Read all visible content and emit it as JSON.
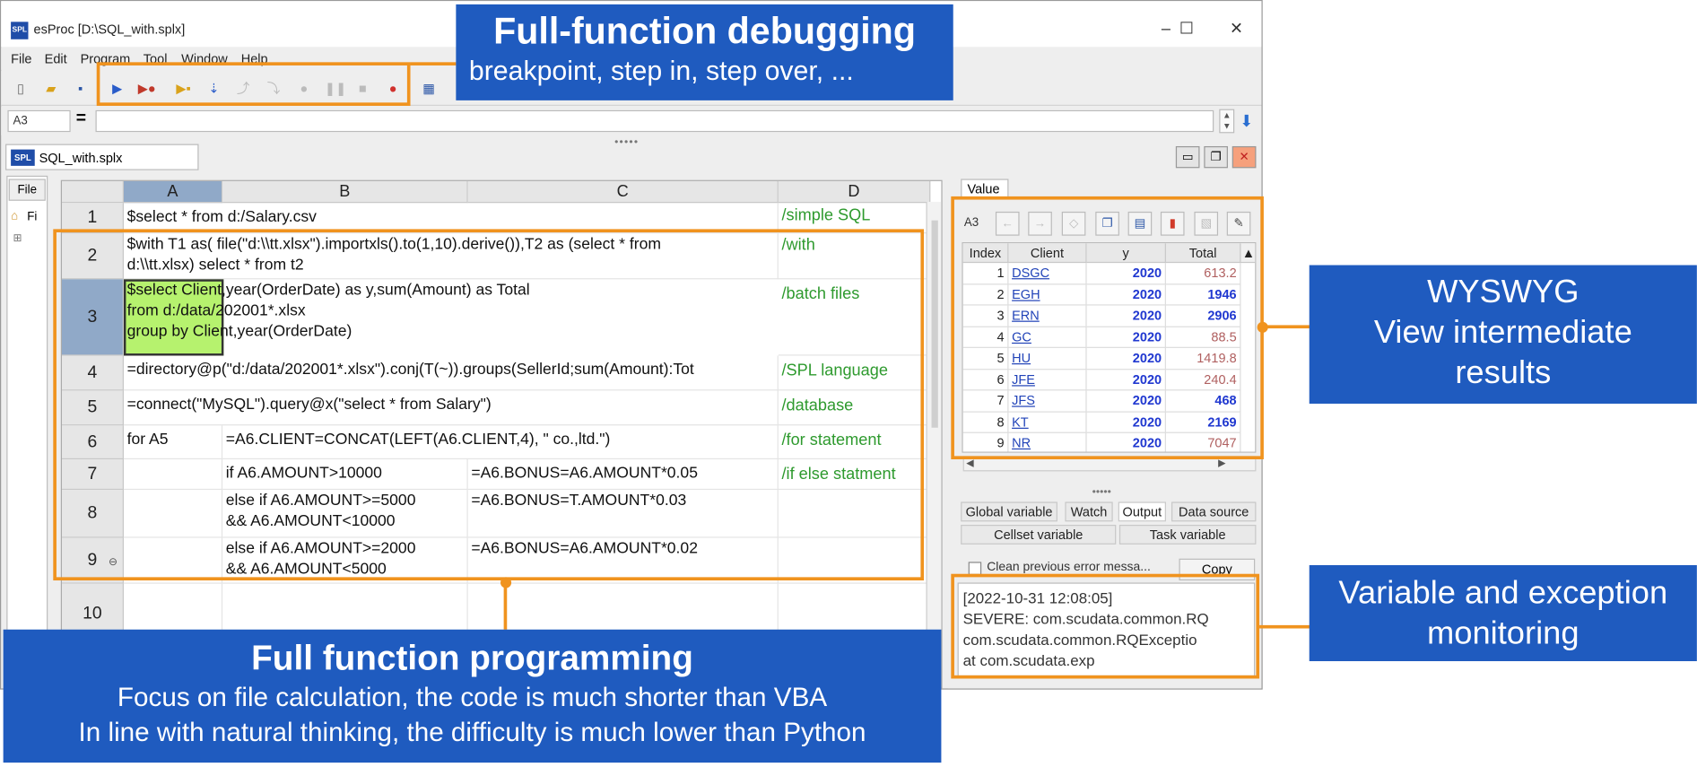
{
  "window": {
    "logo": "SPL",
    "title": "esProc  [D:\\SQL_with.splx]",
    "controls": [
      "–",
      "☐",
      "✕"
    ]
  },
  "menu": [
    "File",
    "Edit",
    "Program",
    "Tool",
    "Window",
    "Help"
  ],
  "formula_bar": {
    "cell_ref": "A3",
    "equals": "=",
    "value": ""
  },
  "document_tab": {
    "logo": "SPL",
    "label": "SQL_with.splx"
  },
  "file_panel": {
    "tab": "File",
    "item": "Fi"
  },
  "grid": {
    "columns": [
      "A",
      "B",
      "C",
      "D"
    ],
    "rows": [
      {
        "num": "1",
        "A": "$select * from d:/Salary.csv",
        "B": "",
        "C": "",
        "D": "/simple SQL"
      },
      {
        "num": "2",
        "A": "$with T1 as( file(\"d:\\\\tt.xlsx\").importxls().to(1,10).derive()),T2 as (select * from\nd:\\\\tt.xlsx) select * from t2",
        "B": "",
        "C": "",
        "D": "/with"
      },
      {
        "num": "3",
        "A": "$select Client,year(OrderDate) as y,sum(Amount) as Total\nfrom d:/data/202001*.xlsx\ngroup by Client,year(OrderDate)",
        "B": "",
        "C": "",
        "D": "/batch files"
      },
      {
        "num": "4",
        "A": "=directory@p(\"d:/data/202001*.xlsx\").conj(T(~)).groups(SellerId;sum(Amount):Tot",
        "B": "",
        "C": "",
        "D": "/SPL language"
      },
      {
        "num": "5",
        "A": "=connect(\"MySQL\").query@x(\"select * from Salary\")",
        "B": "",
        "C": "",
        "D": "/database"
      },
      {
        "num": "6",
        "A": "for A5",
        "B": "=A6.CLIENT=CONCAT(LEFT(A6.CLIENT,4), \" co.,ltd.\")",
        "C": "",
        "D": "/for statement"
      },
      {
        "num": "7",
        "A": "",
        "B": "if A6.AMOUNT>10000",
        "C": "=A6.BONUS=A6.AMOUNT*0.05",
        "D": "/if else statment"
      },
      {
        "num": "8",
        "A": "",
        "B": "else if A6.AMOUNT>=5000\n&& A6.AMOUNT<10000",
        "C": "=A6.BONUS=T.AMOUNT*0.03",
        "D": ""
      },
      {
        "num": "9",
        "A": "",
        "B": "else if A6.AMOUNT>=2000\n&& A6.AMOUNT<5000",
        "C": "=A6.BONUS=A6.AMOUNT*0.02",
        "D": ""
      },
      {
        "num": "10",
        "A": "",
        "B": "",
        "C": "",
        "D": ""
      }
    ]
  },
  "value_panel": {
    "tab": "Value",
    "cell_ref": "A3",
    "headers": [
      "Index",
      "Client",
      "y",
      "Total"
    ],
    "rows": [
      [
        "1",
        "DSGC",
        "2020",
        "613.2"
      ],
      [
        "2",
        "EGH",
        "2020",
        "1946"
      ],
      [
        "3",
        "ERN",
        "2020",
        "2906"
      ],
      [
        "4",
        "GC",
        "2020",
        "88.5"
      ],
      [
        "5",
        "HU",
        "2020",
        "1419.8"
      ],
      [
        "6",
        "JFE",
        "2020",
        "240.4"
      ],
      [
        "7",
        "JFS",
        "2020",
        "468"
      ],
      [
        "8",
        "KT",
        "2020",
        "2169"
      ],
      [
        "9",
        "NR",
        "2020",
        "7047"
      ]
    ]
  },
  "bottom_tabs": {
    "row1": [
      "Global variable",
      "Watch",
      "Output",
      "Data source"
    ],
    "row2": [
      "Cellset variable",
      "Task variable"
    ]
  },
  "error_console": {
    "checkbox_label": "Clean previous error messa...",
    "copy_button": "Copy",
    "lines": [
      "[2022-10-31 12:08:05]",
      "SEVERE: com.scudata.common.RQ",
      "com.scudata.common.RQExceptio",
      "           at com.scudata.exp"
    ]
  },
  "callouts": {
    "debug": {
      "title": "Full-function debugging",
      "subtitle": "breakpoint, step in, step over, ..."
    },
    "wysiwyg": {
      "lines": [
        "WYSWYG",
        "View intermediate",
        "results"
      ]
    },
    "monitor": {
      "lines": [
        "Variable and exception",
        "monitoring"
      ]
    },
    "programming": {
      "title": "Full function programming",
      "lines": [
        "Focus on file calculation, the code is much shorter than VBA",
        "In line with natural thinking, the difficulty is much lower than Python"
      ]
    }
  },
  "colors": {
    "accent": "#f0931e",
    "callout": "#1f5bbf",
    "selected_cell": "#b6f26e",
    "comment": "#2e9a2e"
  }
}
